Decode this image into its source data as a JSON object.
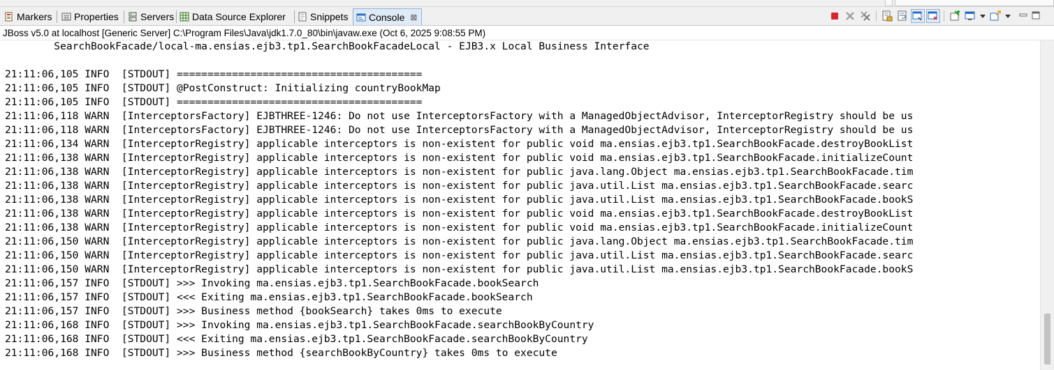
{
  "tabs": [
    {
      "label": "Markers",
      "icon": "markers-icon"
    },
    {
      "label": "Properties",
      "icon": "properties-icon"
    },
    {
      "label": "Servers",
      "icon": "servers-icon"
    },
    {
      "label": "Data Source Explorer",
      "icon": "data-source-icon"
    },
    {
      "label": "Snippets",
      "icon": "snippets-icon"
    },
    {
      "label": "Console",
      "icon": "console-icon",
      "active": true,
      "close": "⊠"
    }
  ],
  "toolbar": {
    "icons": [
      "terminate-icon",
      "remove-launch-icon",
      "remove-all-terminated-icon",
      "scroll-lock-icon",
      "word-wrap-icon",
      "show-console-on-stdout-icon",
      "show-console-on-stderr-icon",
      "pin-console-icon",
      "display-selected-console-icon",
      "display-console-dropdown-icon",
      "open-console-icon",
      "open-console-dropdown-icon",
      "minimize-icon",
      "maximize-icon"
    ],
    "colors": {
      "terminate": "#d9252b",
      "disabled": "#a0a0a0",
      "accent": "#2a6ebb"
    }
  },
  "launch_title": "JBoss v5.0 at localhost [Generic Server] C:\\Program Files\\Java\\jdk1.7.0_80\\bin\\javaw.exe (Oct 6, 2025 9:08:55 PM)",
  "console_lines": [
    "        SearchBookFacade/local-ma.ensias.ejb3.tp1.SearchBookFacadeLocal - EJB3.x Local Business Interface",
    "",
    "21:11:06,105 INFO  [STDOUT] ========================================",
    "21:11:06,105 INFO  [STDOUT] @PostConstruct: Initializing countryBookMap",
    "21:11:06,105 INFO  [STDOUT] ========================================",
    "21:11:06,118 WARN  [InterceptorsFactory] EJBTHREE-1246: Do not use InterceptorsFactory with a ManagedObjectAdvisor, InterceptorRegistry should be us",
    "21:11:06,118 WARN  [InterceptorsFactory] EJBTHREE-1246: Do not use InterceptorsFactory with a ManagedObjectAdvisor, InterceptorRegistry should be us",
    "21:11:06,134 WARN  [InterceptorRegistry] applicable interceptors is non-existent for public void ma.ensias.ejb3.tp1.SearchBookFacade.destroyBookList",
    "21:11:06,138 WARN  [InterceptorRegistry] applicable interceptors is non-existent for public void ma.ensias.ejb3.tp1.SearchBookFacade.initializeCount",
    "21:11:06,138 WARN  [InterceptorRegistry] applicable interceptors is non-existent for public java.lang.Object ma.ensias.ejb3.tp1.SearchBookFacade.tim",
    "21:11:06,138 WARN  [InterceptorRegistry] applicable interceptors is non-existent for public java.util.List ma.ensias.ejb3.tp1.SearchBookFacade.searc",
    "21:11:06,138 WARN  [InterceptorRegistry] applicable interceptors is non-existent for public java.util.List ma.ensias.ejb3.tp1.SearchBookFacade.bookS",
    "21:11:06,138 WARN  [InterceptorRegistry] applicable interceptors is non-existent for public void ma.ensias.ejb3.tp1.SearchBookFacade.destroyBookList",
    "21:11:06,138 WARN  [InterceptorRegistry] applicable interceptors is non-existent for public void ma.ensias.ejb3.tp1.SearchBookFacade.initializeCount",
    "21:11:06,150 WARN  [InterceptorRegistry] applicable interceptors is non-existent for public java.lang.Object ma.ensias.ejb3.tp1.SearchBookFacade.tim",
    "21:11:06,150 WARN  [InterceptorRegistry] applicable interceptors is non-existent for public java.util.List ma.ensias.ejb3.tp1.SearchBookFacade.searc",
    "21:11:06,150 WARN  [InterceptorRegistry] applicable interceptors is non-existent for public java.util.List ma.ensias.ejb3.tp1.SearchBookFacade.bookS",
    "21:11:06,157 INFO  [STDOUT] >>> Invoking ma.ensias.ejb3.tp1.SearchBookFacade.bookSearch",
    "21:11:06,157 INFO  [STDOUT] <<< Exiting ma.ensias.ejb3.tp1.SearchBookFacade.bookSearch",
    "21:11:06,157 INFO  [STDOUT] >>> Business method {bookSearch} takes 0ms to execute",
    "21:11:06,168 INFO  [STDOUT] >>> Invoking ma.ensias.ejb3.tp1.SearchBookFacade.searchBookByCountry",
    "21:11:06,168 INFO  [STDOUT] <<< Exiting ma.ensias.ejb3.tp1.SearchBookFacade.searchBookByCountry",
    "21:11:06,168 INFO  [STDOUT] >>> Business method {searchBookByCountry} takes 0ms to execute"
  ]
}
